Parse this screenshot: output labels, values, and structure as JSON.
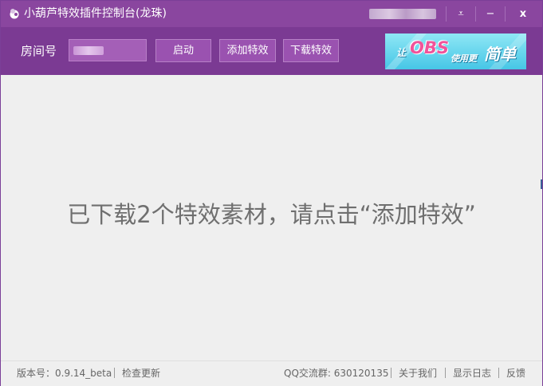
{
  "window": {
    "title": "小葫芦特效插件控制台(龙珠)",
    "controls": {
      "menu_glyph": "⩡",
      "minimize_glyph": "−",
      "close_glyph": "x"
    }
  },
  "toolbar": {
    "room_label": "房间号",
    "start_label": "启动",
    "add_effect_label": "添加特效",
    "download_effect_label": "下载特效",
    "banner": {
      "text_1": "让",
      "text_obs": "OBS",
      "text_2": "使用更",
      "text_3": "简单"
    }
  },
  "main": {
    "message": "已下载2个特效素材，请点击“添加特效”"
  },
  "statusbar": {
    "version": "版本号：0.9.14_beta",
    "check_update": "检查更新",
    "qq_group": "QQ交流群: 630120135",
    "about_us": "关于我们",
    "show_log": "显示日志",
    "feedback": "反馈"
  },
  "colors": {
    "titlebar": "#8a469f",
    "toolbar": "#7b3a93",
    "button": "#9a52b0",
    "content_bg": "#efefef",
    "message_text": "#6f6f6f"
  },
  "icons": [
    "app-icon",
    "menu-icon",
    "minimize-icon",
    "close-icon"
  ]
}
